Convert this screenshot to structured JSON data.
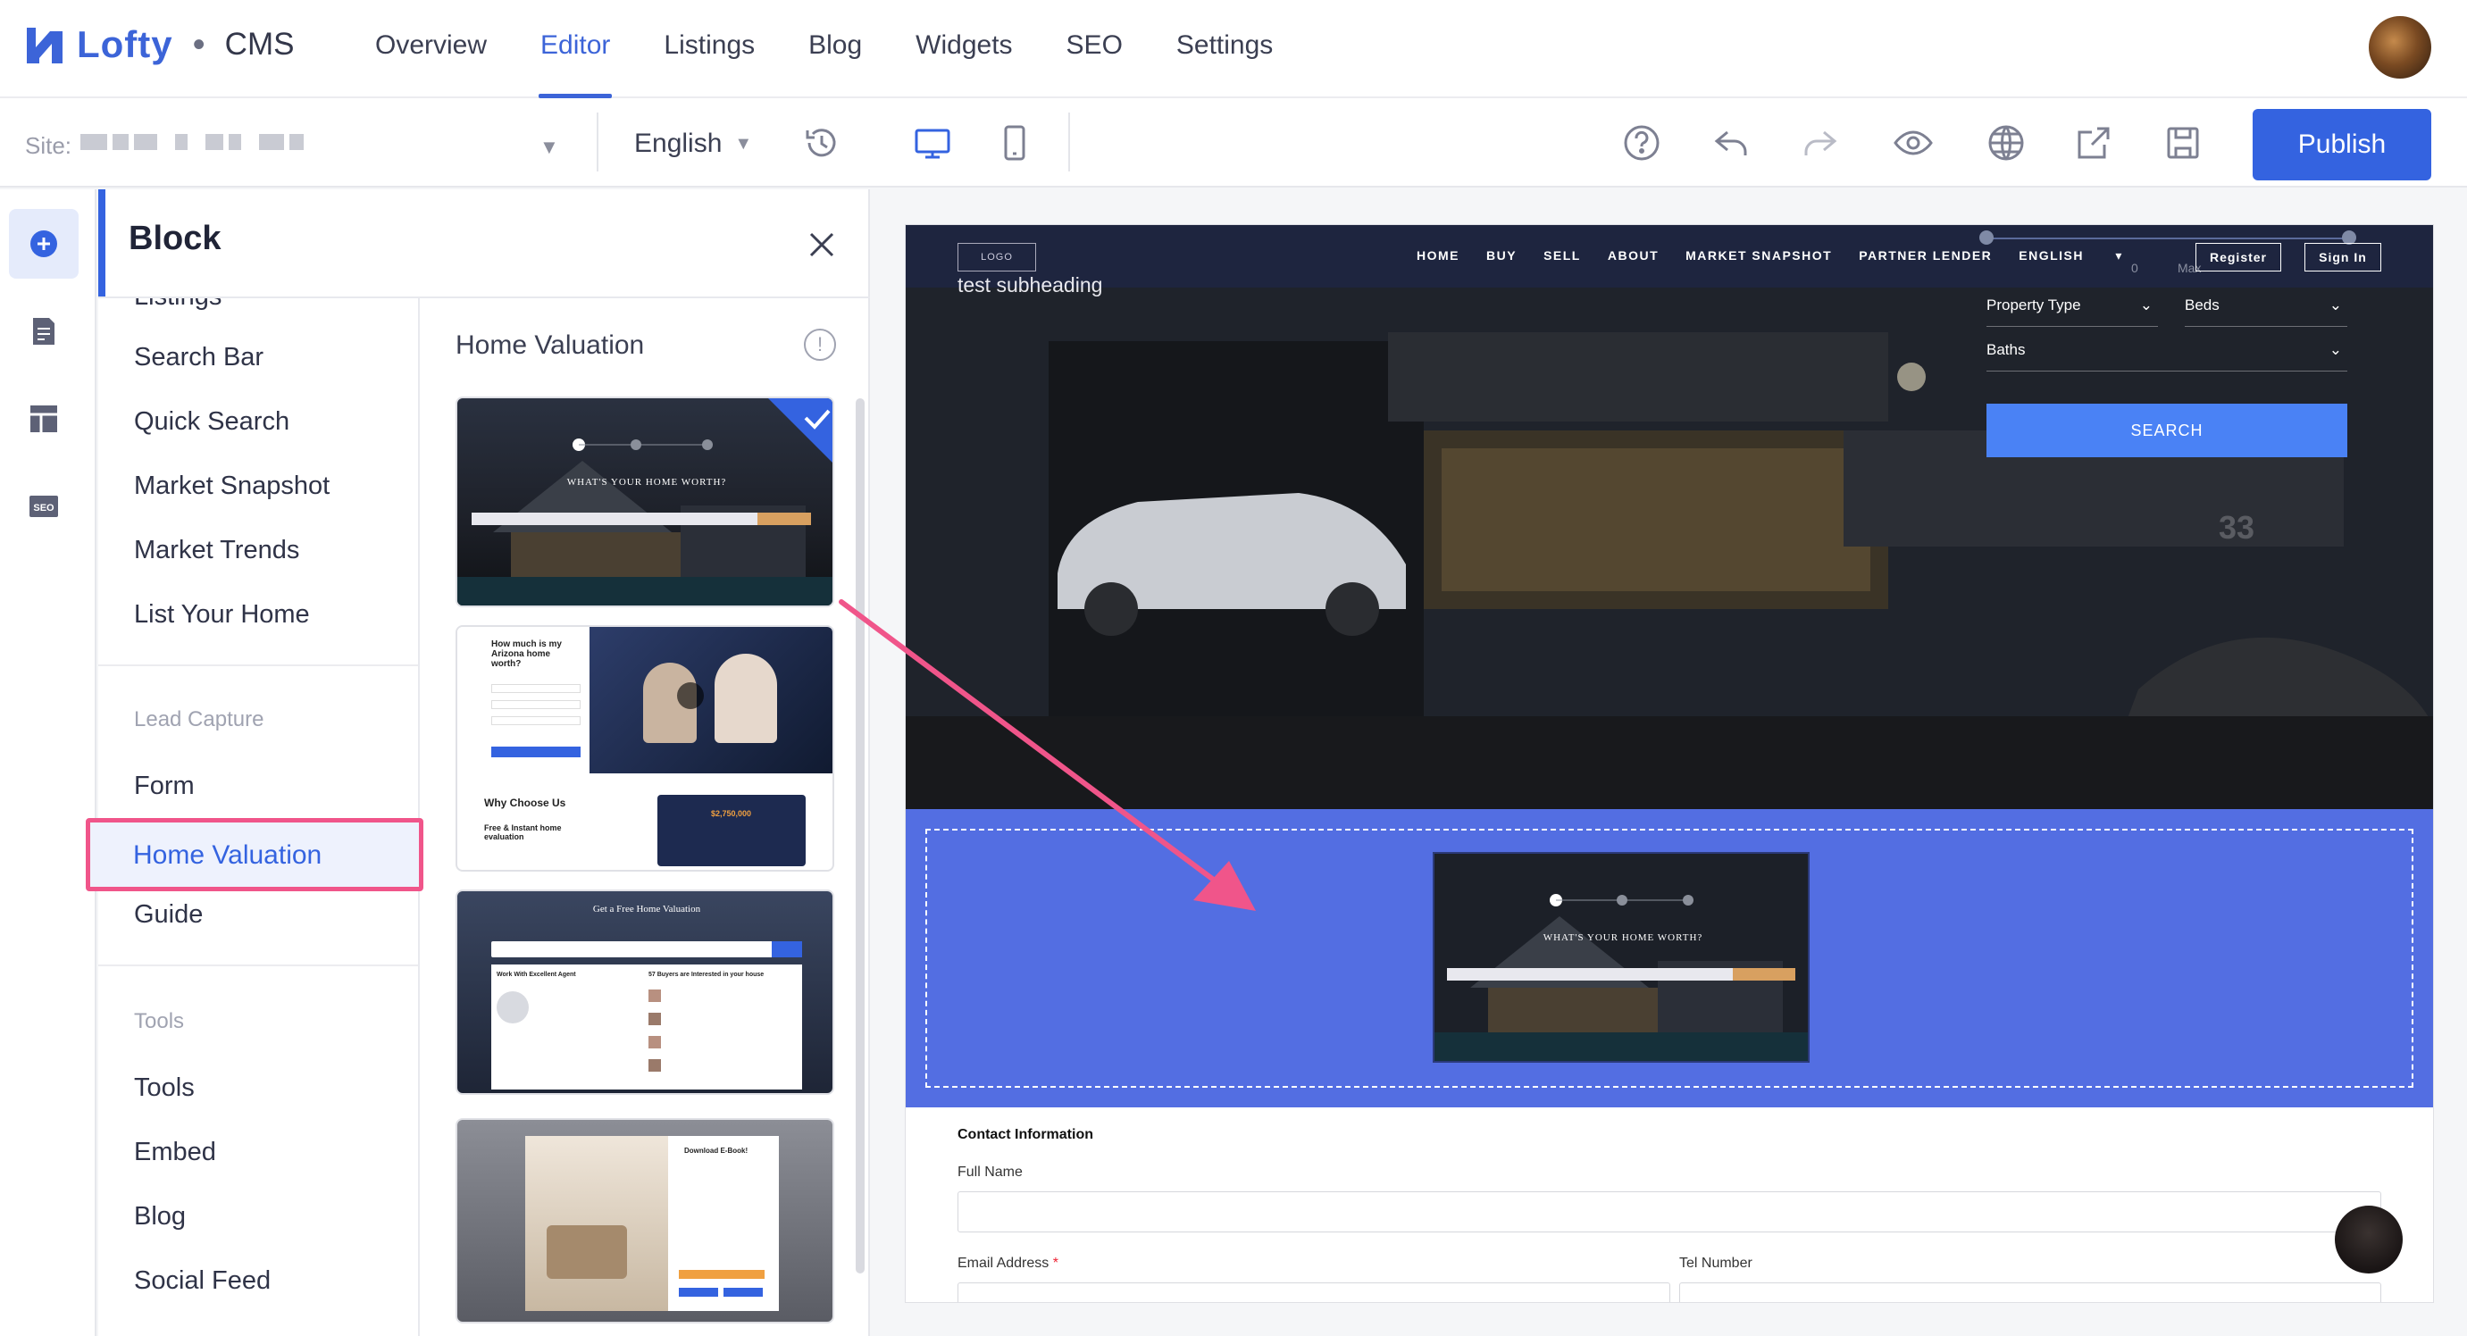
{
  "app": {
    "brand": "Lofty",
    "separator": "•",
    "product": "CMS"
  },
  "nav": {
    "tabs": [
      "Overview",
      "Editor",
      "Listings",
      "Blog",
      "Widgets",
      "SEO",
      "Settings"
    ],
    "active": "Editor"
  },
  "toolbar": {
    "site_label": "Site:",
    "language": "English",
    "publish_label": "Publish"
  },
  "block_panel": {
    "title": "Block",
    "partial_item": "Listings",
    "items_top": [
      "Search Bar",
      "Quick Search",
      "Market Snapshot",
      "Market Trends",
      "List Your Home"
    ],
    "group_lead": "Lead Capture",
    "items_lead": [
      "Form",
      "Home Valuation",
      "Guide"
    ],
    "selected": "Home Valuation",
    "group_tools": "Tools",
    "items_tools": [
      "Tools",
      "Embed",
      "Blog",
      "Social Feed"
    ]
  },
  "templates": {
    "title": "Home Valuation",
    "t1": {
      "heading": "WHAT'S YOUR HOME WORTH?"
    },
    "t2": {
      "heading": "How much is my Arizona home worth?",
      "why": "Why Choose Us",
      "sub": "Free & Instant home evaluation",
      "price": "$2,750,000"
    },
    "t3": {
      "heading": "Get a Free Home Valuation",
      "left": "Work With Excellent Agent",
      "right": "57 Buyers are Interested in your house"
    },
    "t4": {
      "heading": "Download E-Book!"
    }
  },
  "site_preview": {
    "logo": "LOGO",
    "subheading": "test subheading",
    "nav": [
      "HOME",
      "BUY",
      "SELL",
      "ABOUT",
      "MARKET SNAPSHOT",
      "PARTNER LENDER"
    ],
    "language": "ENGLISH",
    "register": "Register",
    "signin": "Sign In",
    "range_min": "0",
    "range_max": "Max",
    "property_type": "Property Type",
    "beds": "Beds",
    "baths": "Baths",
    "search": "SEARCH",
    "house_number": "33",
    "drop_heading": "WHAT'S YOUR HOME WORTH?",
    "contact_title": "Contact Information",
    "full_name": "Full Name",
    "email": "Email Address",
    "required_mark": "*",
    "tel": "Tel Number"
  },
  "colors": {
    "accent": "#3463e0",
    "highlight": "#f0558a",
    "dropzone": "#536ee2"
  }
}
